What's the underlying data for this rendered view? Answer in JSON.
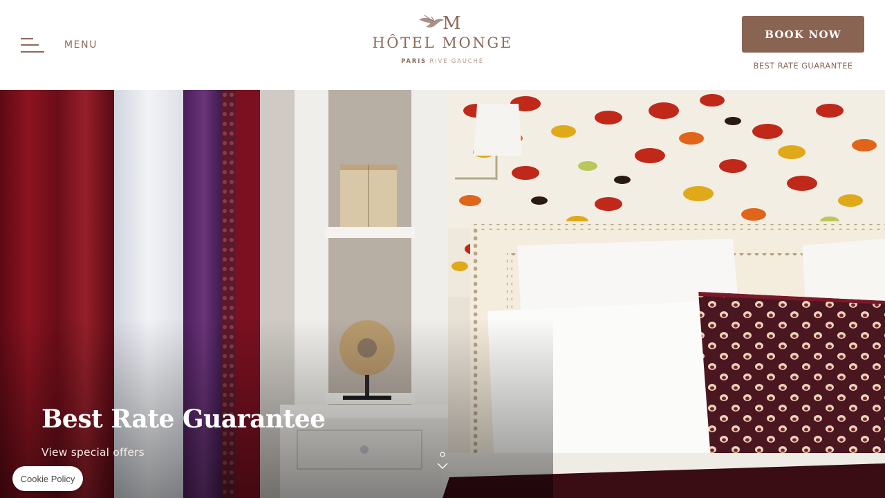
{
  "header": {
    "menu_label": "MENU",
    "logo": {
      "name": "HÔTEL MONGE",
      "city": "PARIS",
      "district": "RIVE GAUCHE",
      "monogram": "M"
    },
    "book_label": "BOOK NOW",
    "rate_link": "BEST RATE GUARANTEE"
  },
  "hero": {
    "title": "Best Rate Guarantee",
    "link": "View special offers"
  },
  "cookie": {
    "label": "Cookie Policy"
  },
  "icons": {
    "menu": "hamburger-icon",
    "logo_bird": "bird-icon",
    "scroll": "chevron-down-icon"
  },
  "colors": {
    "brand": "#8a6453",
    "text_brand": "#8a6a5c",
    "background": "#ffffff"
  }
}
